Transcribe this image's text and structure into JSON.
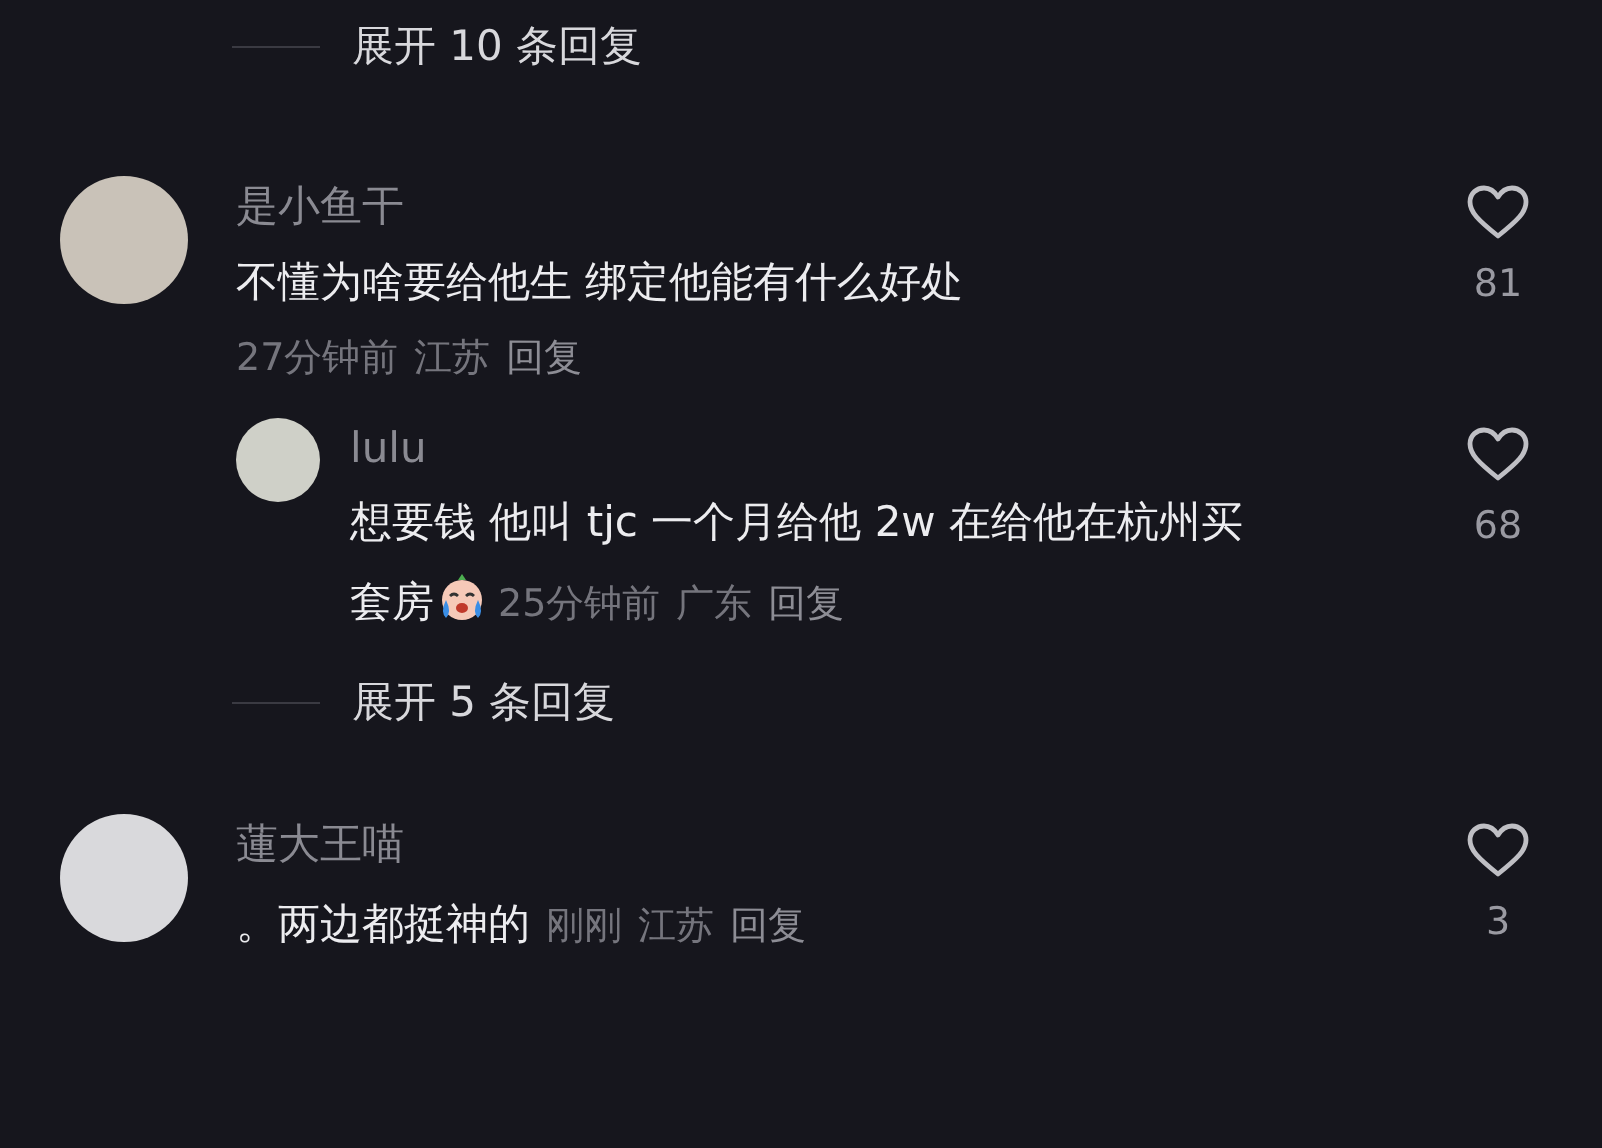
{
  "top_expand": {
    "label": "展开 10 条回复"
  },
  "comments": [
    {
      "name": "是小鱼干",
      "text": "不懂为啥要给他生  绑定他能有什么好处",
      "meta_inline": false,
      "time": "27分钟前",
      "location": "江苏",
      "reply": "回复",
      "likes": "81",
      "liked": false,
      "replies": [
        {
          "name": "lulu",
          "text_lines": [
            "想要钱 他叫 tjc 一个月给他 2w 在给他在杭州买",
            "套房"
          ],
          "emoji": true,
          "time": "25分钟前",
          "location": "广东",
          "reply": "回复",
          "likes": "68",
          "liked": false
        }
      ],
      "expand": "展开 5 条回复"
    },
    {
      "name": "蓮大王喵",
      "text": "。两边都挺神的",
      "meta_inline": true,
      "time": "刚刚",
      "location": "江苏",
      "reply": "回复",
      "likes": "3",
      "liked": false
    }
  ]
}
